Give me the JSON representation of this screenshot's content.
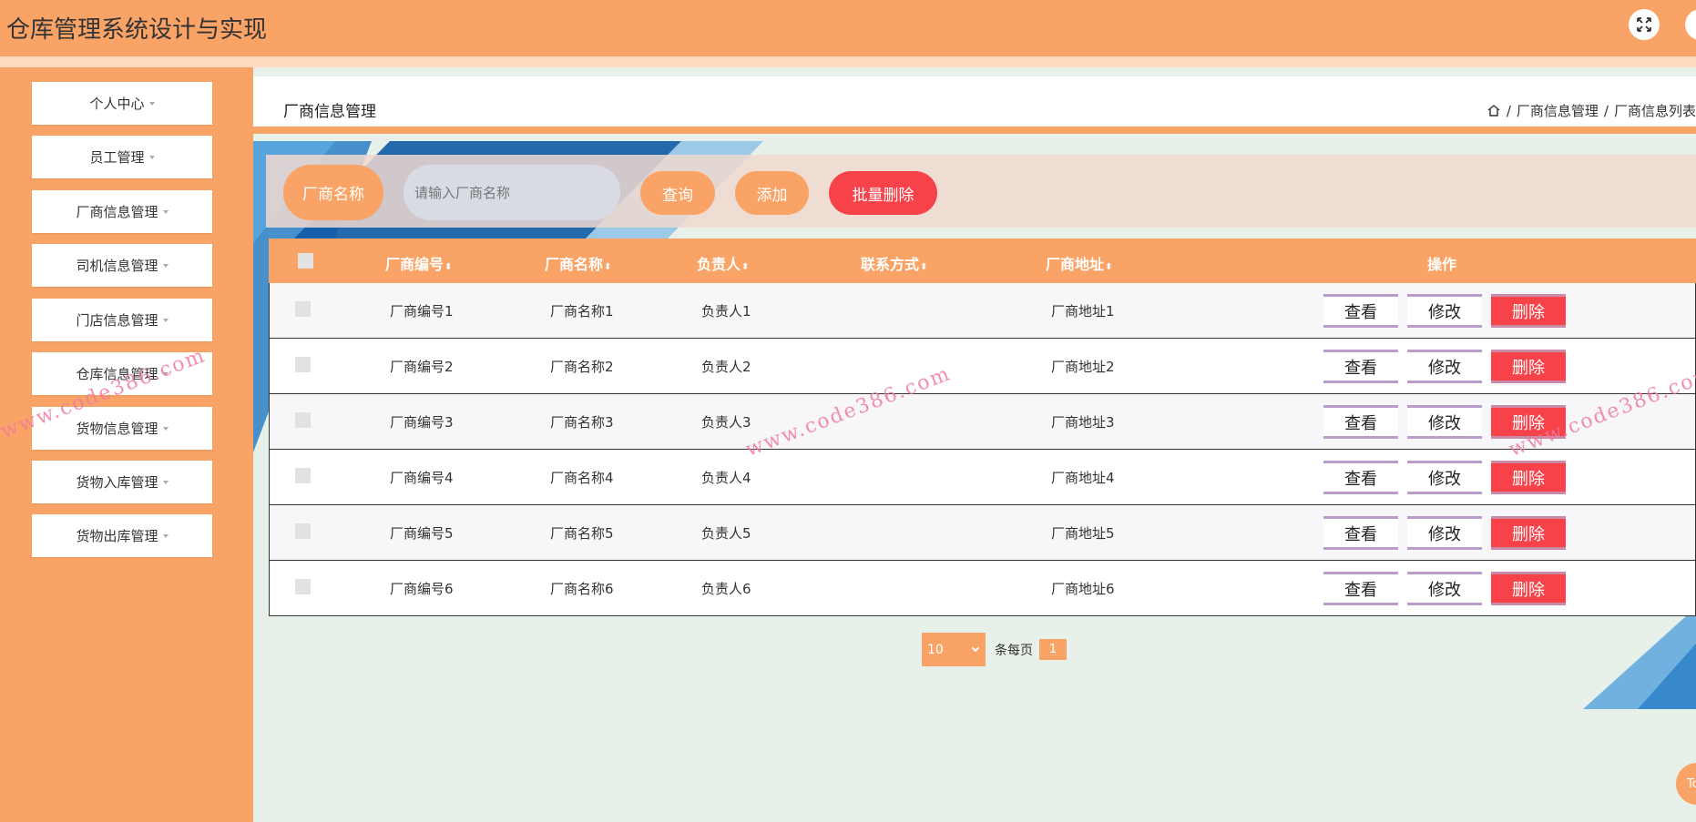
{
  "app": {
    "title": "仓库管理系统设计与实现"
  },
  "sidebar": {
    "items": [
      {
        "label": "个人中心"
      },
      {
        "label": "员工管理"
      },
      {
        "label": "厂商信息管理"
      },
      {
        "label": "司机信息管理"
      },
      {
        "label": "门店信息管理"
      },
      {
        "label": "仓库信息管理"
      },
      {
        "label": "货物信息管理"
      },
      {
        "label": "货物入库管理"
      },
      {
        "label": "货物出库管理"
      }
    ]
  },
  "page": {
    "title": "厂商信息管理",
    "breadcrumb": [
      "厂商信息管理",
      "厂商信息列表"
    ]
  },
  "search": {
    "field_label": "厂商名称",
    "placeholder": "请输入厂商名称",
    "query_label": "查询",
    "add_label": "添加",
    "batch_delete_label": "批量删除"
  },
  "table": {
    "columns": [
      "厂商编号",
      "厂商名称",
      "负责人",
      "联系方式",
      "厂商地址",
      "操作"
    ],
    "rows": [
      {
        "code": "厂商编号1",
        "name": "厂商名称1",
        "owner": "负责人1",
        "contact": "",
        "address": "厂商地址1"
      },
      {
        "code": "厂商编号2",
        "name": "厂商名称2",
        "owner": "负责人2",
        "contact": "",
        "address": "厂商地址2"
      },
      {
        "code": "厂商编号3",
        "name": "厂商名称3",
        "owner": "负责人3",
        "contact": "",
        "address": "厂商地址3"
      },
      {
        "code": "厂商编号4",
        "name": "厂商名称4",
        "owner": "负责人4",
        "contact": "",
        "address": "厂商地址4"
      },
      {
        "code": "厂商编号5",
        "name": "厂商名称5",
        "owner": "负责人5",
        "contact": "",
        "address": "厂商地址5"
      },
      {
        "code": "厂商编号6",
        "name": "厂商名称6",
        "owner": "负责人6",
        "contact": "",
        "address": "厂商地址6"
      }
    ],
    "actions": {
      "view": "查看",
      "edit": "修改",
      "delete": "删除"
    }
  },
  "pagination": {
    "page_size": "10",
    "per_page_label": "条每页",
    "current_page": "1"
  },
  "back_to_top": {
    "label": "To"
  },
  "watermark": "www.code386.com",
  "colors": {
    "primary": "#f9a366",
    "danger": "#f7424a",
    "background": "#e7f1ea"
  }
}
